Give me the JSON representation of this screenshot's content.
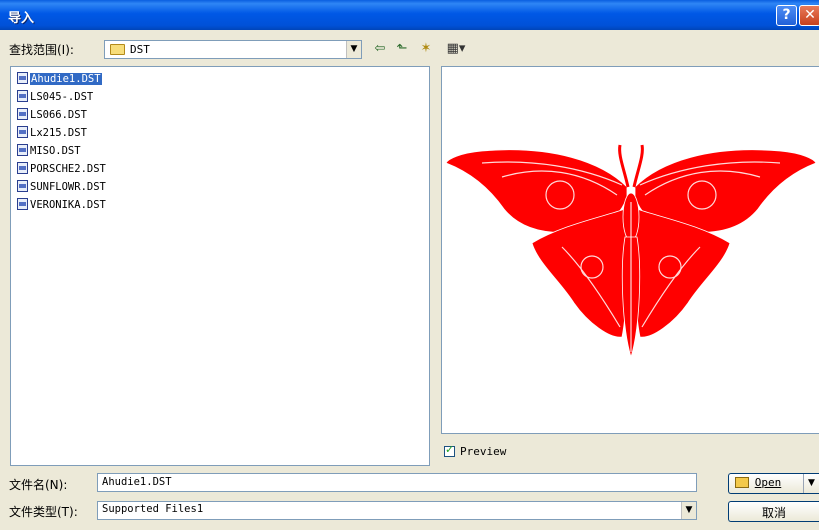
{
  "window": {
    "title": "导入",
    "help_glyph": "?",
    "close_glyph": "✕"
  },
  "lookin": {
    "label": "查找范围(I):",
    "value": "DST"
  },
  "toolbar": {
    "back_glyph": "⇦",
    "up_glyph": "⬑",
    "new_folder_glyph": "✶",
    "view_glyph": "▦▾"
  },
  "files": [
    {
      "name": "Ahudie1.DST",
      "selected": true
    },
    {
      "name": "LS045-.DST"
    },
    {
      "name": "LS066.DST"
    },
    {
      "name": "Lx215.DST"
    },
    {
      "name": "MISO.DST"
    },
    {
      "name": "PORSCHE2.DST"
    },
    {
      "name": "SUNFLOWR.DST"
    },
    {
      "name": "VERONIKA.DST"
    }
  ],
  "preview": {
    "label": "Preview",
    "checked": true,
    "image_color": "#ff0000"
  },
  "filename": {
    "label": "文件名(N):",
    "value": "Ahudie1.DST"
  },
  "filetype": {
    "label": "文件类型(T):",
    "value": "Supported Files1"
  },
  "buttons": {
    "open": "Open",
    "cancel": "取消"
  },
  "colors": {
    "title_bar": "#0054e3",
    "selection": "#316ac5",
    "dialog_bg": "#ece9d8"
  }
}
